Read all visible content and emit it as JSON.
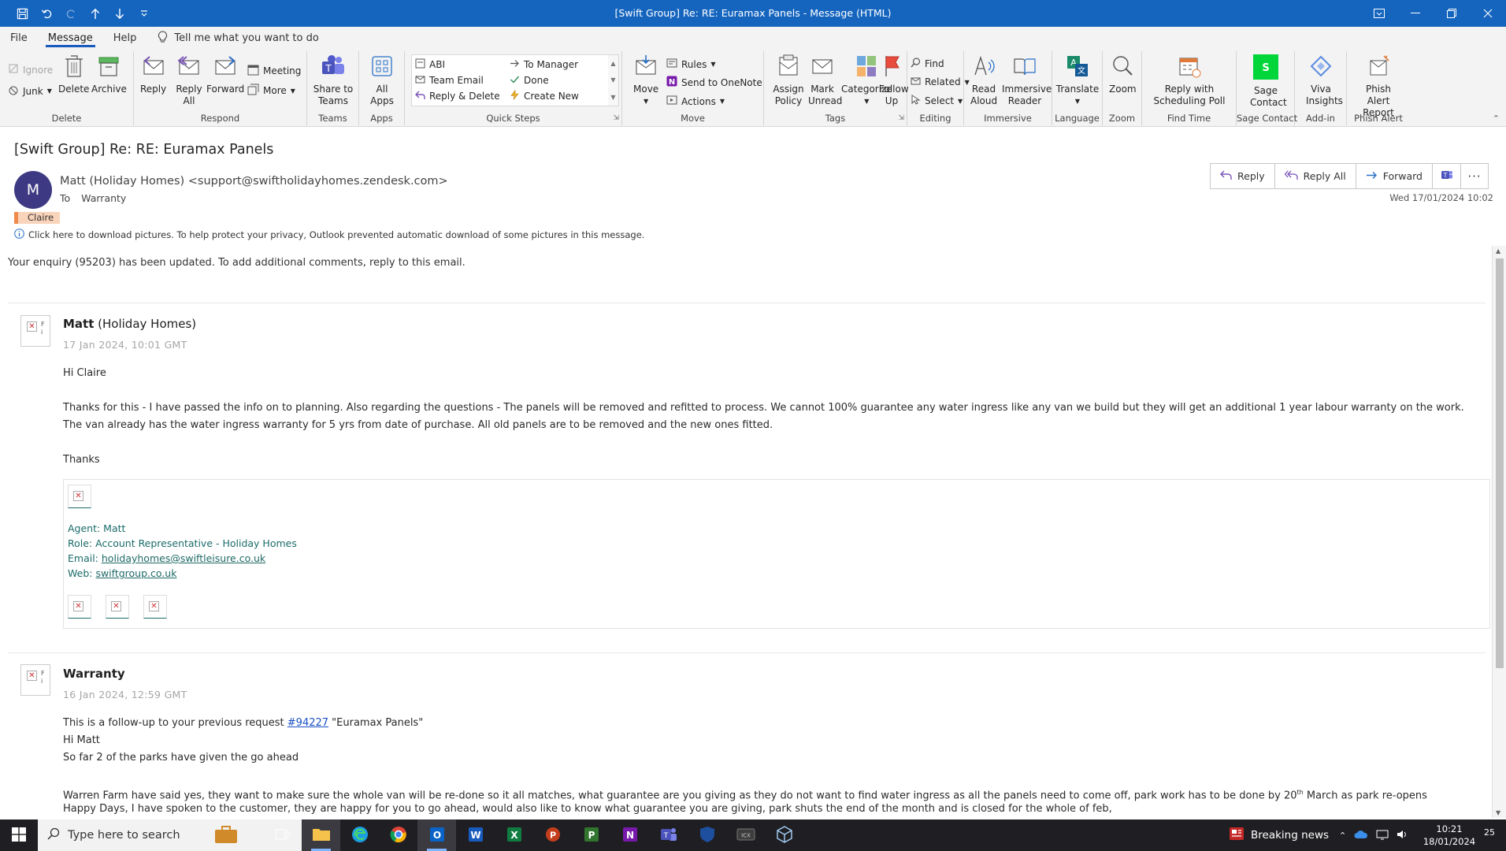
{
  "window": {
    "title": "[Swift Group] Re: RE: Euramax Panels - Message (HTML)"
  },
  "menu": {
    "tabs": [
      "File",
      "Message",
      "Help"
    ],
    "tell_me": "Tell me what you want to do"
  },
  "ribbon": {
    "delete_group": {
      "label": "Delete",
      "ignore": "Ignore",
      "junk": "Junk",
      "delete": "Delete",
      "archive": "Archive"
    },
    "respond_group": {
      "label": "Respond",
      "reply": "Reply",
      "reply_all": "Reply All",
      "forward": "Forward",
      "meeting": "Meeting",
      "more": "More"
    },
    "teams_group": {
      "label": "Teams",
      "share": "Share to Teams"
    },
    "apps_group": {
      "label": "Apps",
      "all_apps": "All Apps"
    },
    "quick_steps": {
      "label": "Quick Steps",
      "items": [
        "ABI",
        "To Manager",
        "Team Email",
        "Done",
        "Reply & Delete",
        "Create New"
      ]
    },
    "move_group": {
      "label": "Move",
      "move": "Move",
      "rules": "Rules",
      "onenote": "Send to OneNote",
      "actions": "Actions"
    },
    "tags_group": {
      "label": "Tags",
      "assign_policy": "Assign Policy",
      "mark_unread": "Mark Unread",
      "categorize": "Categorize",
      "follow_up": "Follow Up"
    },
    "editing_group": {
      "label": "Editing",
      "find": "Find",
      "related": "Related",
      "select": "Select"
    },
    "immersive_group": {
      "label": "Immersive",
      "read_aloud": "Read Aloud",
      "immersive_reader": "Immersive Reader"
    },
    "language_group": {
      "label": "Language",
      "translate": "Translate"
    },
    "zoom_group": {
      "label": "Zoom",
      "zoom": "Zoom"
    },
    "findtime_group": {
      "label": "Find Time",
      "reply_poll": "Reply with Scheduling Poll"
    },
    "sage_group": {
      "label": "Sage Contact",
      "sage": "Sage Contact"
    },
    "addin_group": {
      "label": "Add-in",
      "viva": "Viva Insights"
    },
    "phish_group": {
      "label": "Phish Alert",
      "phish": "Phish Alert Report"
    }
  },
  "header": {
    "subject": "[Swift Group] Re: RE: Euramax Panels",
    "avatar_initial": "M",
    "from": "Matt (Holiday Homes) <support@swiftholidayhomes.zendesk.com>",
    "to_label": "To",
    "to_value": "Warranty",
    "category": "Claire",
    "info": "Click here to download pictures. To help protect your privacy, Outlook prevented automatic download of some pictures in this message.",
    "date": "Wed 17/01/2024 10:02",
    "actions": {
      "reply": "Reply",
      "reply_all": "Reply All",
      "forward": "Forward"
    }
  },
  "body": {
    "intro": "Your enquiry (95203) has been updated. To add additional comments, reply to this email.",
    "msg1": {
      "sender_bold": "Matt",
      "sender_rest": " (Holiday Homes)",
      "date": "17 Jan 2024, 10:01 GMT",
      "greeting": "Hi Claire",
      "para": "Thanks for this - I have passed the info on to planning. Also regarding the questions - The panels will be removed and refitted to process. We cannot 100% guarantee any water ingress like any van we build but they will get an additional 1 year labour warranty on the work. The van already has the water ingress warranty for 5 yrs from date of purchase. All old panels are to be removed and the new ones fitted.",
      "thanks": "Thanks",
      "sig": {
        "agent": "Agent: Matt",
        "role": "Role: Account Representative - Holiday Homes",
        "email_label": "Email: ",
        "email": "holidayhomes@swiftleisure.co.uk",
        "web_label": "Web: ",
        "web": "swiftgroup.co.uk"
      }
    },
    "msg2": {
      "sender": "Warranty",
      "date": "16 Jan 2024, 12:59 GMT",
      "line1_pre": "This is a follow-up to your previous request ",
      "line1_link": "#94227",
      "line1_post": " \"Euramax Panels\"",
      "line2": "Hi Matt",
      "line3": "So far 2 of the parks have given the go ahead",
      "line4_pre": "Warren Farm have said yes, they want to make sure the whole van will be re-done so it all matches, what guarantee are you giving as they do not want to find water ingress as all the panels need to come off, park work has to be done by 20",
      "line4_sup": "th",
      "line4_post": " March as park re-opens",
      "line5": "Happy Days, I have spoken to the customer, they are happy for you to go ahead, would also like to know what guarantee you are giving, park shuts the end of the month and is closed for the whole of feb,"
    }
  },
  "taskbar": {
    "search_placeholder": "Type here to search",
    "news": "Breaking news",
    "time": "10:21",
    "date": "18/01/2024",
    "notif_count": "25"
  },
  "colors": {
    "titlebar": "#1565bf",
    "accent": "#185abd",
    "avatar": "#3d3a83",
    "signature_text": "#1a6b69"
  }
}
